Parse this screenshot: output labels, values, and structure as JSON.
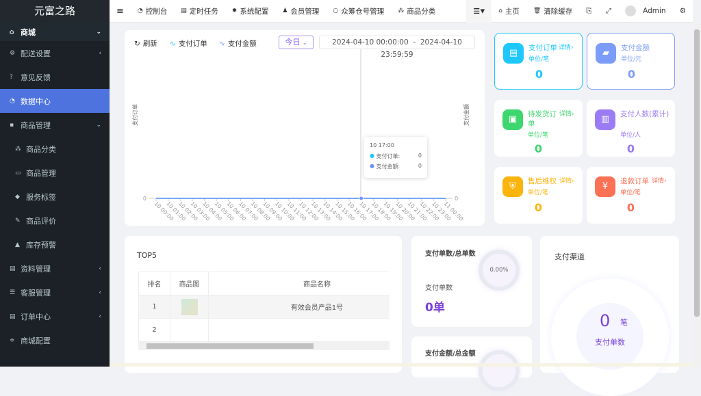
{
  "sidebar": {
    "logo": "元富之路",
    "items": [
      {
        "label": "商城",
        "icon": "home-icon",
        "expanded": true
      },
      {
        "label": "配送设置",
        "icon": "cogs-icon"
      },
      {
        "label": "意见反馈",
        "icon": "question-icon"
      },
      {
        "label": "数据中心",
        "icon": "dashboard-icon",
        "active": true
      },
      {
        "label": "商品管理",
        "icon": "box-icon",
        "expanded": true
      },
      {
        "label": "商品分类",
        "icon": "sitemap-icon",
        "sub": true
      },
      {
        "label": "商品管理",
        "icon": "bag-icon",
        "sub": true
      },
      {
        "label": "服务标签",
        "icon": "tag-icon",
        "sub": true
      },
      {
        "label": "商品评价",
        "icon": "edit-icon",
        "sub": true
      },
      {
        "label": "库存预警",
        "icon": "warning-icon",
        "sub": true
      },
      {
        "label": "资料管理",
        "icon": "file-icon"
      },
      {
        "label": "客服管理",
        "icon": "list-icon"
      },
      {
        "label": "订单中心",
        "icon": "file-icon"
      },
      {
        "label": "商城配置",
        "icon": "sliders-icon"
      }
    ]
  },
  "topbar": {
    "nav": [
      "控制台",
      "定时任务",
      "系统配置",
      "会员管理",
      "众筹仓号管理",
      "商品分类"
    ],
    "home": "主页",
    "clear_cache": "清除缓存",
    "user": "Admin"
  },
  "chart_controls": {
    "refresh": "刷新",
    "legend_orders": "支付订单",
    "legend_amount": "支付金额",
    "period": "今日",
    "range_start": "2024-04-10 00:00:00",
    "range_sep": "-",
    "range_end": "2024-04-10 23:59:59"
  },
  "chart_data": {
    "type": "line",
    "ylabel_left": "支付订单",
    "ylabel_right": "支付金额",
    "x": [
      "10 00:00",
      "10 01:00",
      "10 02:00",
      "10 03:00",
      "10 04:00",
      "10 05:00",
      "10 06:00",
      "10 07:00",
      "10 08:00",
      "10 09:00",
      "10 10:00",
      "10 11:00",
      "10 12:00",
      "10 13:00",
      "10 14:00",
      "10 15:00",
      "10 16:00",
      "10 17:00",
      "10 18:00",
      "10 19:00",
      "10 20:00",
      "10 21:00",
      "10 22:00",
      "10 23:00",
      "11 00:00"
    ],
    "series": [
      {
        "name": "支付订单",
        "color": "#1ec8ff",
        "values": [
          0,
          0,
          0,
          0,
          0,
          0,
          0,
          0,
          0,
          0,
          0,
          0,
          0,
          0,
          0,
          0,
          0,
          0,
          0,
          0,
          0,
          0,
          0,
          0,
          0
        ]
      },
      {
        "name": "支付金额",
        "color": "#6f95fa",
        "values": [
          0,
          0,
          0,
          0,
          0,
          0,
          0,
          0,
          0,
          0,
          0,
          0,
          0,
          0,
          0,
          0,
          0,
          0,
          0,
          0,
          0,
          0,
          0,
          0,
          0
        ]
      }
    ],
    "y_tick_left": "0",
    "y_tick_right": "0",
    "tooltip": {
      "title": "10 17:00",
      "rows": [
        {
          "label": "支付订单:",
          "value": "0"
        },
        {
          "label": "支付金额:",
          "value": "0"
        }
      ]
    }
  },
  "stats": [
    {
      "title": "支付订单",
      "detail": "详情›",
      "unit": "单位/笔",
      "value": "0",
      "color": "#1ec8ff",
      "icon": "document-icon"
    },
    {
      "title": "支付金额",
      "detail": "",
      "unit": "单位/元",
      "value": "0",
      "color": "#7b9cf8",
      "icon": "wallet-icon"
    },
    {
      "title": "待发货订单",
      "detail": "详情›",
      "unit": "单位/笔",
      "value": "0",
      "color": "#3ed66e",
      "icon": "package-icon"
    },
    {
      "title": "支付人数(累计)",
      "detail": "",
      "unit": "单位/人",
      "value": "0",
      "color": "#9c7cf5",
      "icon": "bar-chart-icon"
    },
    {
      "title": "售后维权",
      "detail": "详情›",
      "unit": "单位/笔",
      "value": "0",
      "color": "#fbb40c",
      "icon": "shield-yen-icon"
    },
    {
      "title": "退款订单",
      "detail": "详情›",
      "unit": "单位/笔",
      "value": "0",
      "color": "#fb7155",
      "icon": "refund-icon"
    }
  ],
  "top5": {
    "title": "TOP5",
    "headers": [
      "排名",
      "商品图",
      "商品名称"
    ],
    "rows": [
      {
        "rank": "1",
        "name": "有效会员产品1号"
      },
      {
        "rank": "2",
        "name": ""
      }
    ]
  },
  "ratio1": {
    "title": "支付单数/总单数",
    "percent": "0.00%",
    "label": "支付单数",
    "value": "0单"
  },
  "ratio2": {
    "title": "支付金额/总金额"
  },
  "channel": {
    "title": "支付渠道",
    "value": "0",
    "unit": "笔",
    "label": "支付单数"
  }
}
